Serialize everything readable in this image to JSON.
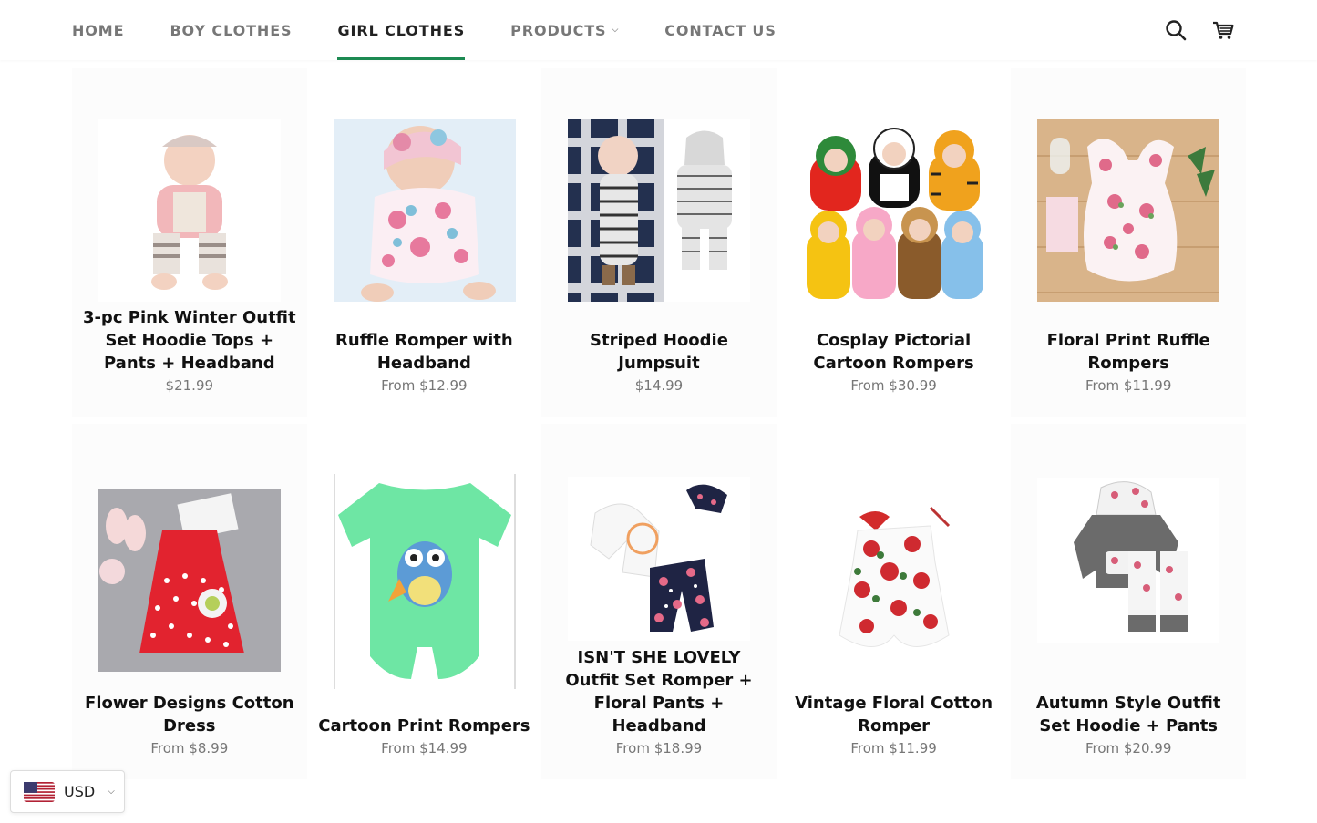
{
  "nav": {
    "items": [
      {
        "label": "HOME"
      },
      {
        "label": "BOY CLOTHES"
      },
      {
        "label": "GIRL CLOTHES"
      },
      {
        "label": "PRODUCTS"
      },
      {
        "label": "CONTACT US"
      }
    ],
    "active": "GIRL CLOTHES"
  },
  "header_icons": [
    "search-icon",
    "cart-icon"
  ],
  "products": [
    {
      "title": "3-pc Pink Winter Outfit Set Hoodie Tops + Pants + Headband",
      "price": "$21.99"
    },
    {
      "title": "Ruffle Romper with Headband",
      "price": "From $12.99"
    },
    {
      "title": "Striped Hoodie Jumpsuit",
      "price": "$14.99"
    },
    {
      "title": "Cosplay Pictorial Cartoon Rompers",
      "price": "From $30.99"
    },
    {
      "title": "Floral Print Ruffle Rompers",
      "price": "From $11.99"
    },
    {
      "title": "Flower Designs Cotton Dress",
      "price": "From $8.99"
    },
    {
      "title": "Cartoon Print Rompers",
      "price": "From $14.99"
    },
    {
      "title": "ISN'T SHE LOVELY Outfit Set Romper + Floral Pants + Headband",
      "price": "From $18.99"
    },
    {
      "title": "Vintage Floral Cotton Romper",
      "price": "From $11.99"
    },
    {
      "title": "Autumn Style Outfit Set Hoodie + Pants",
      "price": "From $20.99"
    }
  ],
  "currency": {
    "code": "USD",
    "flag_icon": "us-flag-icon"
  },
  "colors": {
    "accent": "#1d8a52",
    "nav_text": "#777777",
    "price_text": "#777777"
  }
}
